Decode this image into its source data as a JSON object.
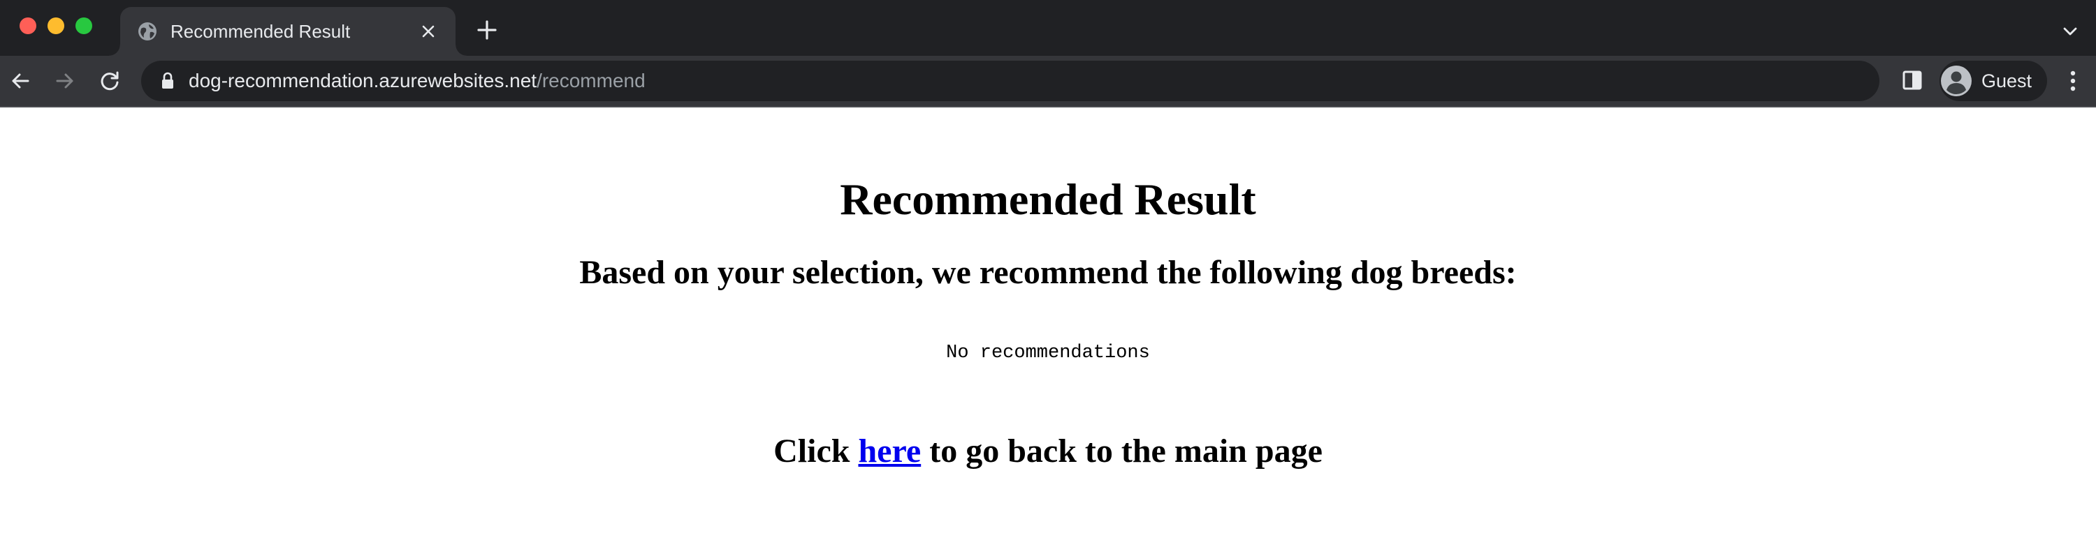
{
  "browser": {
    "tab": {
      "title": "Recommended Result"
    },
    "address_bar": {
      "host": "dog-recommendation.azurewebsites.net",
      "path": "/recommend"
    },
    "profile": {
      "label": "Guest"
    },
    "icons": {
      "tab_favicon": "globe-icon",
      "tab_close": "close-icon",
      "new_tab": "plus-icon",
      "tab_search": "chevron-down-icon",
      "back": "arrow-left-icon",
      "forward": "arrow-right-icon",
      "reload": "reload-icon",
      "lock": "lock-icon",
      "side_panel": "side-panel-icon",
      "avatar": "person-icon",
      "menu": "kebab-menu-icon"
    },
    "colors": {
      "frame": "#202124",
      "toolbar": "#35363a",
      "text": "#e8eaed",
      "muted_text": "#9aa0a6"
    }
  },
  "page": {
    "title": "Recommended Result",
    "subtitle": "Based on your selection, we recommend the following dog breeds:",
    "result": "No recommendations",
    "back_prefix": "Click ",
    "back_link": "here",
    "back_suffix": " to go back to the main page",
    "link_color": "#0000ee"
  }
}
